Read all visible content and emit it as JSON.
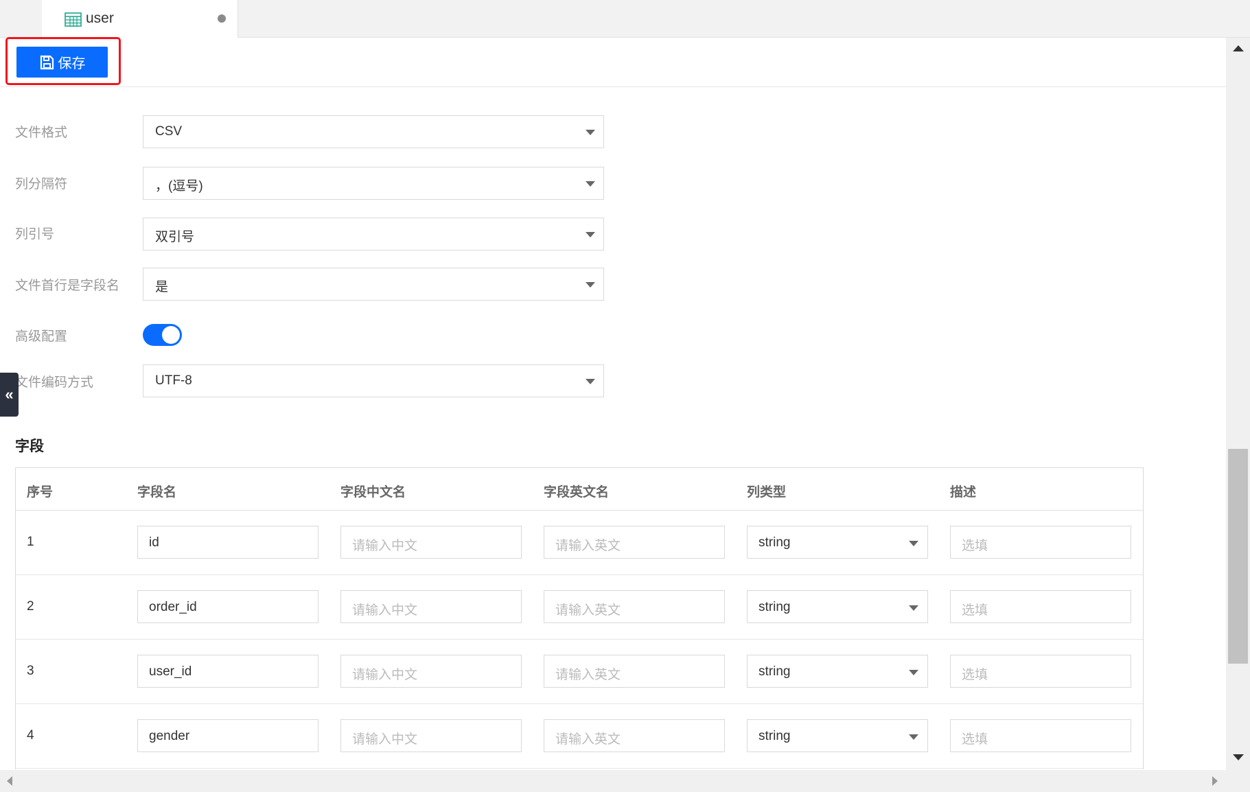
{
  "tab": {
    "label": "user",
    "icon": "table-grid-icon"
  },
  "toolbar": {
    "save_label": "保存",
    "save_icon": "floppy-disk-icon",
    "accent": "#0a6cff",
    "highlight_color": "#f2141b"
  },
  "form": {
    "file_format": {
      "label": "文件格式",
      "value": "CSV"
    },
    "column_delimiter": {
      "label": "列分隔符",
      "value": "，(逗号)"
    },
    "column_quote": {
      "label": "列引号",
      "value": "双引号"
    },
    "header_row": {
      "label": "文件首行是字段名",
      "value": "是"
    },
    "advanced": {
      "label": "高级配置",
      "enabled": true
    },
    "encoding": {
      "label": "文件编码方式",
      "value": "UTF-8"
    }
  },
  "side_handle": "«",
  "fields": {
    "title": "字段",
    "columns": [
      "序号",
      "字段名",
      "字段中文名",
      "字段英文名",
      "列类型",
      "描述"
    ],
    "rows": [
      {
        "index": "1",
        "name": "id",
        "cn_placeholder": "请输入中文",
        "en_placeholder": "请输入英文",
        "type": "string",
        "desc_placeholder": "选填"
      },
      {
        "index": "2",
        "name": "order_id",
        "cn_placeholder": "请输入中文",
        "en_placeholder": "请输入英文",
        "type": "string",
        "desc_placeholder": "选填"
      },
      {
        "index": "3",
        "name": "user_id",
        "cn_placeholder": "请输入中文",
        "en_placeholder": "请输入英文",
        "type": "string",
        "desc_placeholder": "选填"
      },
      {
        "index": "4",
        "name": "gender",
        "cn_placeholder": "请输入中文",
        "en_placeholder": "请输入英文",
        "type": "string",
        "desc_placeholder": "选填"
      }
    ]
  }
}
